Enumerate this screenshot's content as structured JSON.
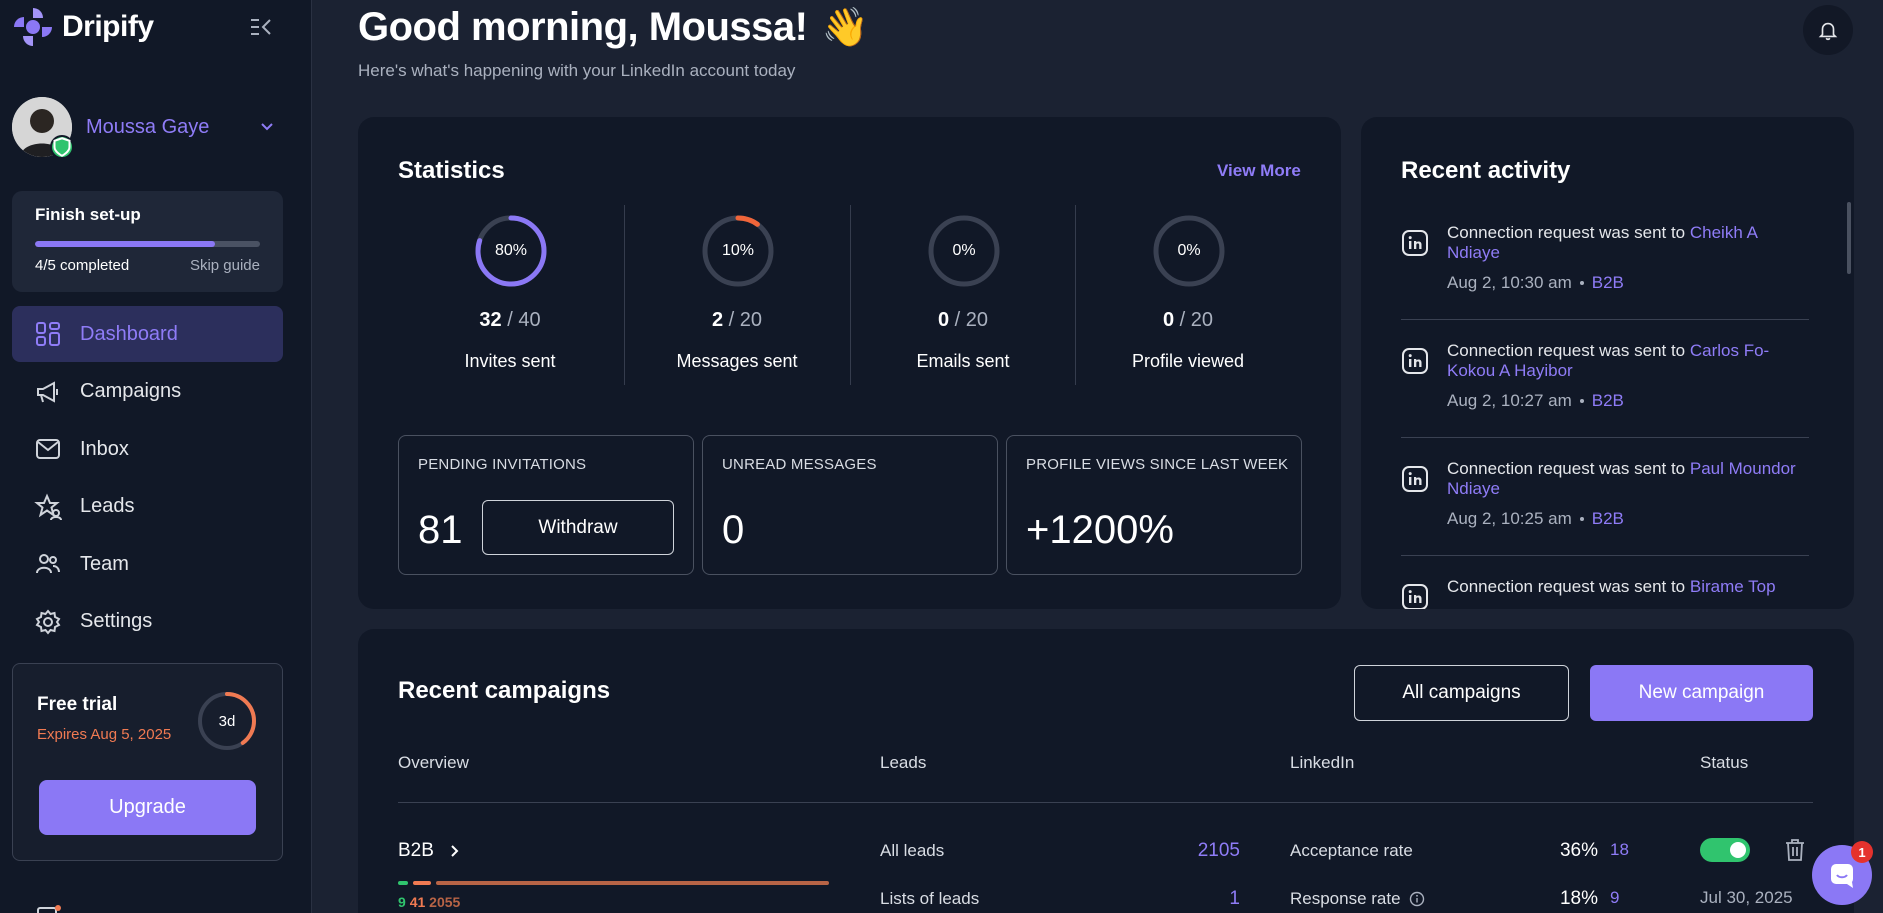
{
  "brand": {
    "name": "Dripify"
  },
  "profile": {
    "name": "Moussa Gaye"
  },
  "setup": {
    "title": "Finish set-up",
    "progress": 0.8,
    "completed": "4/5 completed",
    "skip": "Skip guide"
  },
  "nav": {
    "items": [
      {
        "label": "Dashboard",
        "icon": "grid-icon",
        "active": true
      },
      {
        "label": "Campaigns",
        "icon": "megaphone-icon"
      },
      {
        "label": "Inbox",
        "icon": "envelope-icon"
      },
      {
        "label": "Leads",
        "icon": "star-person-icon"
      },
      {
        "label": "Team",
        "icon": "team-icon"
      },
      {
        "label": "Settings",
        "icon": "gear-icon"
      }
    ]
  },
  "trial": {
    "title": "Free trial",
    "expires": "Expires Aug 5, 2025",
    "days_left": "3d",
    "ring_fraction": 0.4,
    "upgrade": "Upgrade"
  },
  "header": {
    "greeting": "Good morning, Moussa!",
    "wave": "👋",
    "subtitle": "Here's what's happening with your LinkedIn account today"
  },
  "statistics": {
    "title": "Statistics",
    "view_more": "View More",
    "items": [
      {
        "pct": "80%",
        "value": 0.8,
        "count": "32",
        "total": "/ 40",
        "label": "Invites sent",
        "color": "#8b78f5"
      },
      {
        "pct": "10%",
        "value": 0.1,
        "count": "2",
        "total": "/ 20",
        "label": "Messages sent",
        "color": "#f0653a"
      },
      {
        "pct": "0%",
        "value": 0,
        "count": "0",
        "total": "/ 20",
        "label": "Emails sent",
        "color": "#8b78f5"
      },
      {
        "pct": "0%",
        "value": 0,
        "count": "0",
        "total": "/ 20",
        "label": "Profile viewed",
        "color": "#8b78f5"
      }
    ],
    "pending": {
      "label": "PENDING INVITATIONS",
      "value": "81",
      "withdraw": "Withdraw"
    },
    "unread": {
      "label": "UNREAD MESSAGES",
      "value": "0"
    },
    "views": {
      "label": "PROFILE VIEWS SINCE LAST WEEK",
      "value": "+1200%"
    }
  },
  "activity": {
    "title": "Recent activity",
    "items": [
      {
        "text": "Connection request was sent to ",
        "name": "Cheikh A Ndiaye",
        "time": "Aug 2, 10:30 am",
        "tag": "B2B"
      },
      {
        "text": "Connection request was sent to ",
        "name": "Carlos Fo-Kokou A Hayibor",
        "time": "Aug 2, 10:27 am",
        "tag": "B2B"
      },
      {
        "text": "Connection request was sent to ",
        "name": "Paul Moundor Ndiaye",
        "time": "Aug 2, 10:25 am",
        "tag": "B2B"
      },
      {
        "text": "Connection request was sent to ",
        "name": "Birame Top",
        "time": "",
        "tag": ""
      }
    ]
  },
  "campaigns": {
    "title": "Recent campaigns",
    "all_btn": "All campaigns",
    "new_btn": "New campaign",
    "columns": [
      "Overview",
      "Leads",
      "LinkedIn",
      "Status"
    ],
    "row": {
      "name": "B2B",
      "n_green": "9",
      "n_orange": "41",
      "n_brown": "2055",
      "all_leads_label": "All leads",
      "all_leads": "2105",
      "lists_label": "Lists of leads",
      "lists": "1",
      "acceptance_label": "Acceptance rate",
      "acceptance_pct": "36%",
      "acceptance_n": "18",
      "response_label": "Response rate",
      "response_pct": "18%",
      "response_n": "9",
      "date": "Jul 30, 2025",
      "active": true
    }
  },
  "chat": {
    "badge": "1"
  },
  "colors": {
    "accent": "#8b78f5",
    "orange": "#f07a52",
    "green": "#30c46e",
    "bg": "#1b2232",
    "card": "#111827"
  }
}
